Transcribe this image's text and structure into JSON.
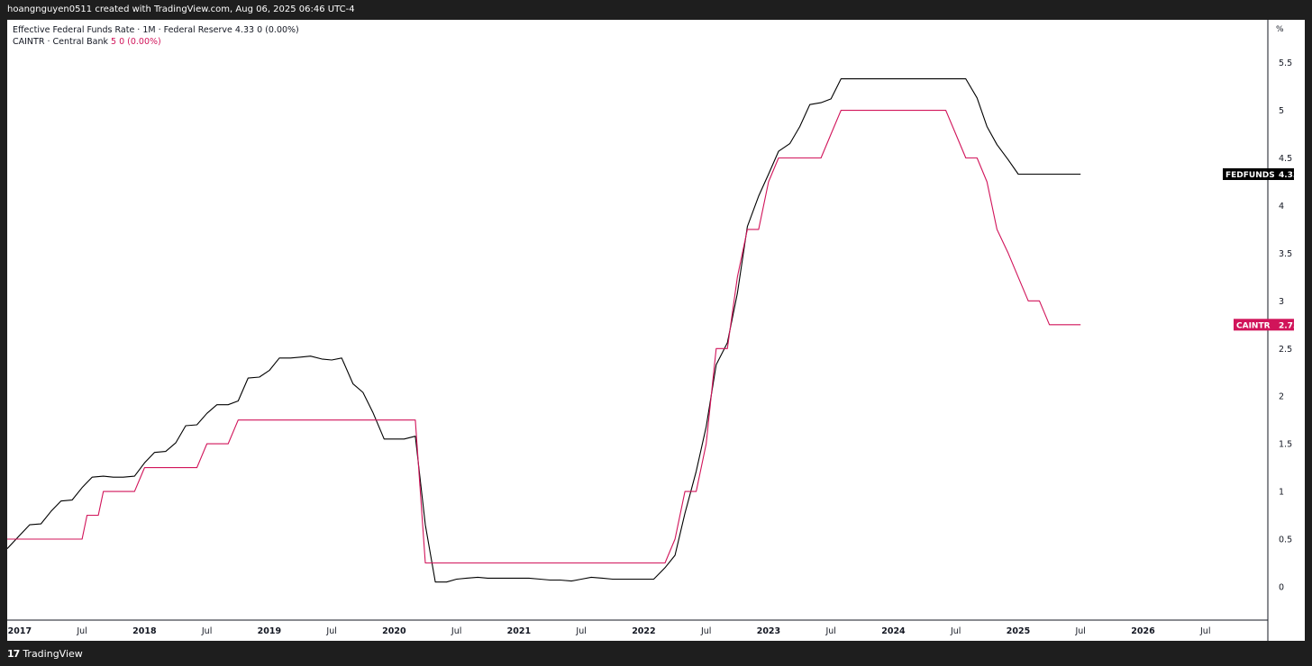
{
  "header": {
    "text": "hoangnguyen0511 created with TradingView.com, Aug 06, 2025 06:46 UTC-4"
  },
  "footer": {
    "brand": "TradingView",
    "logo_glyph": "17"
  },
  "legend": {
    "series1": {
      "title": "Effective Federal Funds Rate · 1M · Federal Reserve",
      "value": "4.33",
      "change": "0 (0.00%)"
    },
    "series2": {
      "title": "CAINTR · Central Bank",
      "value": "5",
      "change": "0 (0.00%)"
    }
  },
  "colors": {
    "fedfunds": "#000000",
    "caintr": "#d1145a",
    "grid": "#e0e3eb"
  },
  "chart_data": {
    "type": "line",
    "y_unit": "%",
    "ylim": [
      -0.35,
      5.95
    ],
    "y_ticks": [
      "5.5",
      "5",
      "4.5",
      "4",
      "3.5",
      "3",
      "2.5",
      "2",
      "1.5",
      "1",
      "0.5",
      "0"
    ],
    "x_start": 2016.9,
    "x_end": 2027.0,
    "x_ticks": [
      {
        "label": "2017",
        "x": 2017.0,
        "bold": true
      },
      {
        "label": "Jul",
        "x": 2017.5,
        "bold": false
      },
      {
        "label": "2018",
        "x": 2018.0,
        "bold": true
      },
      {
        "label": "Jul",
        "x": 2018.5,
        "bold": false
      },
      {
        "label": "2019",
        "x": 2019.0,
        "bold": true
      },
      {
        "label": "Jul",
        "x": 2019.5,
        "bold": false
      },
      {
        "label": "2020",
        "x": 2020.0,
        "bold": true
      },
      {
        "label": "Jul",
        "x": 2020.5,
        "bold": false
      },
      {
        "label": "2021",
        "x": 2021.0,
        "bold": true
      },
      {
        "label": "Jul",
        "x": 2021.5,
        "bold": false
      },
      {
        "label": "2022",
        "x": 2022.0,
        "bold": true
      },
      {
        "label": "Jul",
        "x": 2022.5,
        "bold": false
      },
      {
        "label": "2023",
        "x": 2023.0,
        "bold": true
      },
      {
        "label": "Jul",
        "x": 2023.5,
        "bold": false
      },
      {
        "label": "2024",
        "x": 2024.0,
        "bold": true
      },
      {
        "label": "Jul",
        "x": 2024.5,
        "bold": false
      },
      {
        "label": "2025",
        "x": 2025.0,
        "bold": true
      },
      {
        "label": "Jul",
        "x": 2025.5,
        "bold": false
      },
      {
        "label": "2026",
        "x": 2026.0,
        "bold": true
      },
      {
        "label": "Jul",
        "x": 2026.5,
        "bold": false
      }
    ],
    "series": [
      {
        "name": "FEDFUNDS",
        "last_value": "4.33",
        "points": [
          [
            2016.9,
            0.4
          ],
          [
            2017.0,
            0.54
          ],
          [
            2017.08,
            0.65
          ],
          [
            2017.17,
            0.66
          ],
          [
            2017.25,
            0.79
          ],
          [
            2017.33,
            0.9
          ],
          [
            2017.42,
            0.91
          ],
          [
            2017.5,
            1.04
          ],
          [
            2017.58,
            1.15
          ],
          [
            2017.67,
            1.16
          ],
          [
            2017.75,
            1.15
          ],
          [
            2017.83,
            1.15
          ],
          [
            2017.92,
            1.16
          ],
          [
            2018.0,
            1.3
          ],
          [
            2018.08,
            1.41
          ],
          [
            2018.17,
            1.42
          ],
          [
            2018.25,
            1.51
          ],
          [
            2018.33,
            1.69
          ],
          [
            2018.42,
            1.7
          ],
          [
            2018.5,
            1.82
          ],
          [
            2018.58,
            1.91
          ],
          [
            2018.67,
            1.91
          ],
          [
            2018.75,
            1.95
          ],
          [
            2018.83,
            2.19
          ],
          [
            2018.92,
            2.2
          ],
          [
            2019.0,
            2.27
          ],
          [
            2019.08,
            2.4
          ],
          [
            2019.17,
            2.4
          ],
          [
            2019.25,
            2.41
          ],
          [
            2019.33,
            2.42
          ],
          [
            2019.42,
            2.39
          ],
          [
            2019.5,
            2.38
          ],
          [
            2019.58,
            2.4
          ],
          [
            2019.67,
            2.13
          ],
          [
            2019.75,
            2.04
          ],
          [
            2019.83,
            1.83
          ],
          [
            2019.92,
            1.55
          ],
          [
            2020.0,
            1.55
          ],
          [
            2020.08,
            1.55
          ],
          [
            2020.17,
            1.58
          ],
          [
            2020.25,
            0.65
          ],
          [
            2020.33,
            0.05
          ],
          [
            2020.42,
            0.05
          ],
          [
            2020.5,
            0.08
          ],
          [
            2020.58,
            0.09
          ],
          [
            2020.67,
            0.1
          ],
          [
            2020.75,
            0.09
          ],
          [
            2020.83,
            0.09
          ],
          [
            2020.92,
            0.09
          ],
          [
            2021.0,
            0.09
          ],
          [
            2021.08,
            0.09
          ],
          [
            2021.17,
            0.08
          ],
          [
            2021.25,
            0.07
          ],
          [
            2021.33,
            0.07
          ],
          [
            2021.42,
            0.06
          ],
          [
            2021.5,
            0.08
          ],
          [
            2021.58,
            0.1
          ],
          [
            2021.67,
            0.09
          ],
          [
            2021.75,
            0.08
          ],
          [
            2021.83,
            0.08
          ],
          [
            2021.92,
            0.08
          ],
          [
            2022.0,
            0.08
          ],
          [
            2022.08,
            0.08
          ],
          [
            2022.17,
            0.2
          ],
          [
            2022.25,
            0.33
          ],
          [
            2022.33,
            0.77
          ],
          [
            2022.42,
            1.21
          ],
          [
            2022.5,
            1.68
          ],
          [
            2022.58,
            2.33
          ],
          [
            2022.67,
            2.56
          ],
          [
            2022.75,
            3.08
          ],
          [
            2022.83,
            3.78
          ],
          [
            2022.92,
            4.1
          ],
          [
            2023.0,
            4.33
          ],
          [
            2023.08,
            4.57
          ],
          [
            2023.17,
            4.65
          ],
          [
            2023.25,
            4.83
          ],
          [
            2023.33,
            5.06
          ],
          [
            2023.42,
            5.08
          ],
          [
            2023.5,
            5.12
          ],
          [
            2023.58,
            5.33
          ],
          [
            2024.0,
            5.33
          ],
          [
            2024.5,
            5.33
          ],
          [
            2024.58,
            5.33
          ],
          [
            2024.67,
            5.13
          ],
          [
            2024.75,
            4.83
          ],
          [
            2024.83,
            4.64
          ],
          [
            2024.92,
            4.48
          ],
          [
            2025.0,
            4.33
          ],
          [
            2025.5,
            4.33
          ]
        ]
      },
      {
        "name": "CAINTR",
        "last_value": "2.75",
        "points": [
          [
            2016.9,
            0.5
          ],
          [
            2017.5,
            0.5
          ],
          [
            2017.54,
            0.75
          ],
          [
            2017.63,
            0.75
          ],
          [
            2017.67,
            1.0
          ],
          [
            2017.92,
            1.0
          ],
          [
            2018.0,
            1.25
          ],
          [
            2018.42,
            1.25
          ],
          [
            2018.5,
            1.5
          ],
          [
            2018.67,
            1.5
          ],
          [
            2018.75,
            1.75
          ],
          [
            2019.75,
            1.75
          ],
          [
            2020.0,
            1.75
          ],
          [
            2020.08,
            1.75
          ],
          [
            2020.17,
            1.75
          ],
          [
            2020.25,
            0.25
          ],
          [
            2020.5,
            0.25
          ],
          [
            2021.0,
            0.25
          ],
          [
            2021.5,
            0.25
          ],
          [
            2022.0,
            0.25
          ],
          [
            2022.17,
            0.25
          ],
          [
            2022.25,
            0.5
          ],
          [
            2022.33,
            1.0
          ],
          [
            2022.42,
            1.0
          ],
          [
            2022.5,
            1.5
          ],
          [
            2022.58,
            2.5
          ],
          [
            2022.67,
            2.5
          ],
          [
            2022.75,
            3.25
          ],
          [
            2022.83,
            3.75
          ],
          [
            2022.92,
            3.75
          ],
          [
            2023.0,
            4.25
          ],
          [
            2023.08,
            4.5
          ],
          [
            2023.25,
            4.5
          ],
          [
            2023.33,
            4.5
          ],
          [
            2023.42,
            4.5
          ],
          [
            2023.5,
            4.75
          ],
          [
            2023.58,
            5.0
          ],
          [
            2024.0,
            5.0
          ],
          [
            2024.42,
            5.0
          ],
          [
            2024.5,
            4.75
          ],
          [
            2024.58,
            4.5
          ],
          [
            2024.67,
            4.5
          ],
          [
            2024.75,
            4.25
          ],
          [
            2024.83,
            3.75
          ],
          [
            2024.92,
            3.5
          ],
          [
            2025.0,
            3.25
          ],
          [
            2025.08,
            3.0
          ],
          [
            2025.17,
            3.0
          ],
          [
            2025.25,
            2.75
          ],
          [
            2025.5,
            2.75
          ]
        ]
      }
    ]
  }
}
